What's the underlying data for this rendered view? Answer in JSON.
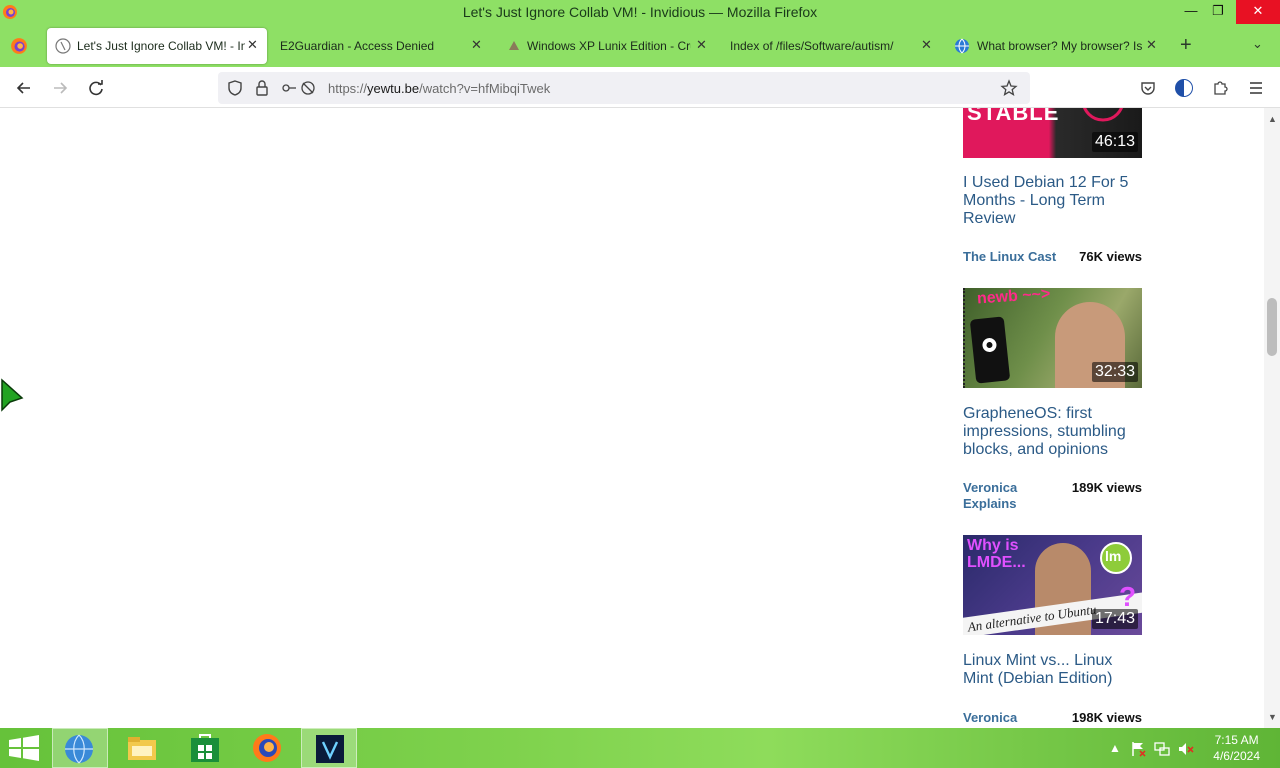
{
  "window": {
    "title": "Let's Just Ignore Collab VM! - Invidious — Mozilla Firefox"
  },
  "tabs": [
    {
      "label": "Let's Just Ignore Collab VM! - In",
      "active": true
    },
    {
      "label": "E2Guardian - Access Denied",
      "active": false
    },
    {
      "label": "Windows XP Lunix Edition - Cru",
      "active": false
    },
    {
      "label": "Index of /files/Software/autism/",
      "active": false
    },
    {
      "label": "What browser? My browser? Is",
      "active": false
    }
  ],
  "navbar": {
    "url_prefix": "https://",
    "url_host": "yewtu.be",
    "url_rest": "/watch?v=hfMibqiTwek"
  },
  "videos": [
    {
      "thumb_text": "STABLE",
      "duration": "46:13",
      "title": "I Used Debian 12 For 5 Months - Long Term Review",
      "channel": "The Linux Cast",
      "views": "76K views"
    },
    {
      "thumb_text": "newb ~~>",
      "duration": "32:33",
      "title": "GrapheneOS: first impressions, stumbling blocks, and opinions",
      "channel": "Veronica Explains",
      "views": "189K views"
    },
    {
      "thumb_text": "Why is LMDE...",
      "thumb_text2": "An alternative to Ubuntu",
      "thumb_badge": "lm",
      "duration": "17:43",
      "title": "Linux Mint vs... Linux Mint (Debian Edition)",
      "channel": "Veronica",
      "views": "198K views"
    }
  ],
  "taskbar": {
    "time": "7:15 AM",
    "date": "4/6/2024",
    "apps": [
      "start-icon",
      "globe-icon",
      "file-explorer-icon",
      "store-icon",
      "firefox-icon",
      "vcs-icon"
    ]
  },
  "colors": {
    "accent": "#8ee065",
    "link": "#2b5a86"
  }
}
